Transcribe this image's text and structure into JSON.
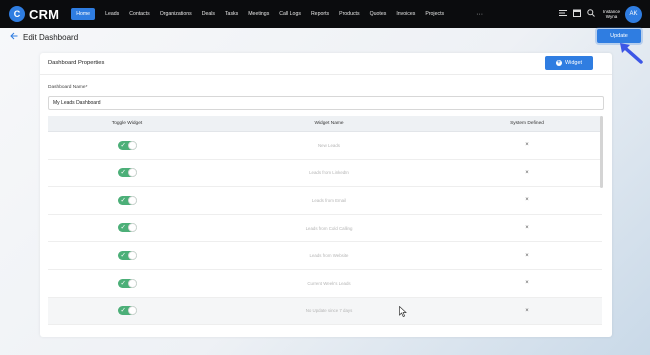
{
  "app": {
    "logo_letter": "C",
    "logo_text": "CRM"
  },
  "nav": [
    {
      "label": "Home",
      "active": true
    },
    {
      "label": "Leads"
    },
    {
      "label": "Contacts"
    },
    {
      "label": "Organizations"
    },
    {
      "label": "Deals"
    },
    {
      "label": "Tasks"
    },
    {
      "label": "Meetings"
    },
    {
      "label": "Call Logs"
    },
    {
      "label": "Reports"
    },
    {
      "label": "Products"
    },
    {
      "label": "Quotes"
    },
    {
      "label": "Invoices"
    },
    {
      "label": "Projects"
    }
  ],
  "nav_more": "···",
  "user": {
    "name_line1": "Instance",
    "name_line2": "Wyna",
    "initials": "AK"
  },
  "header": {
    "title": "Edit Dashboard",
    "update_label": "Update"
  },
  "card": {
    "title": "Dashboard Properties",
    "widget_button": "Widget",
    "name_label": "Dashboard Name*",
    "name_value": "My Leads Dashboard"
  },
  "table": {
    "headers": [
      "Toggle Widget",
      "Widget Name",
      "System Defined"
    ],
    "rows": [
      {
        "name": "New Leads",
        "toggled": true,
        "system": "×"
      },
      {
        "name": "Leads from LinkedIn",
        "toggled": true,
        "system": "×"
      },
      {
        "name": "Leads from Email",
        "toggled": true,
        "system": "×"
      },
      {
        "name": "Leads from Cold Calling",
        "toggled": true,
        "system": "×"
      },
      {
        "name": "Leads from Website",
        "toggled": true,
        "system": "×"
      },
      {
        "name": "Current Week's Leads",
        "toggled": true,
        "system": "×"
      },
      {
        "name": "No Update since 7 days",
        "toggled": true,
        "system": "×"
      }
    ]
  },
  "colors": {
    "accent": "#2f7de1",
    "toggle_on": "#4caf78",
    "topbar": "#0b0c0e"
  }
}
